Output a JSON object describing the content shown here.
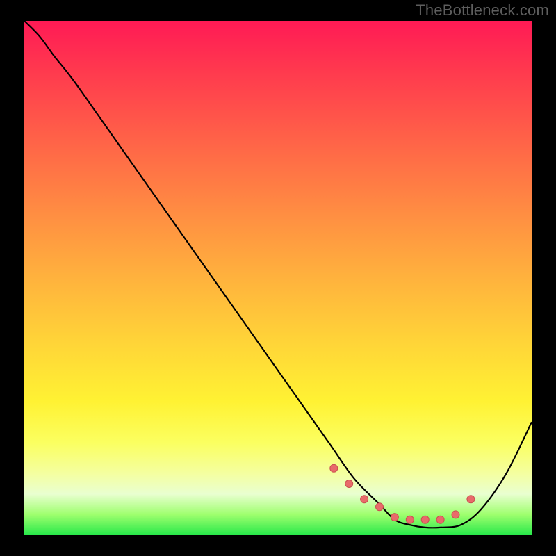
{
  "watermark": "TheBottleneck.com",
  "colors": {
    "background": "#000000",
    "curve": "#000000",
    "bead_fill": "#e86a6a",
    "bead_stroke": "#c94f4f",
    "watermark": "#5e5e5e"
  },
  "chart_data": {
    "type": "line",
    "title": "",
    "xlabel": "",
    "ylabel": "",
    "xlim": [
      0,
      100
    ],
    "ylim": [
      0,
      100
    ],
    "series": [
      {
        "name": "bottleneck-curve",
        "x": [
          0,
          3,
          6,
          10,
          20,
          30,
          40,
          50,
          60,
          65,
          70,
          73,
          76,
          79,
          82,
          86,
          90,
          95,
          100
        ],
        "y": [
          100,
          97,
          93,
          88,
          74,
          60,
          46,
          32,
          18,
          11,
          6,
          3,
          2,
          1.5,
          1.5,
          2,
          5,
          12,
          22
        ]
      }
    ],
    "beads": {
      "name": "highlight-points",
      "x": [
        61,
        64,
        67,
        70,
        73,
        76,
        79,
        82,
        85,
        88
      ],
      "y": [
        13,
        10,
        7,
        5.5,
        3.5,
        3,
        3,
        3,
        4,
        7
      ]
    }
  }
}
